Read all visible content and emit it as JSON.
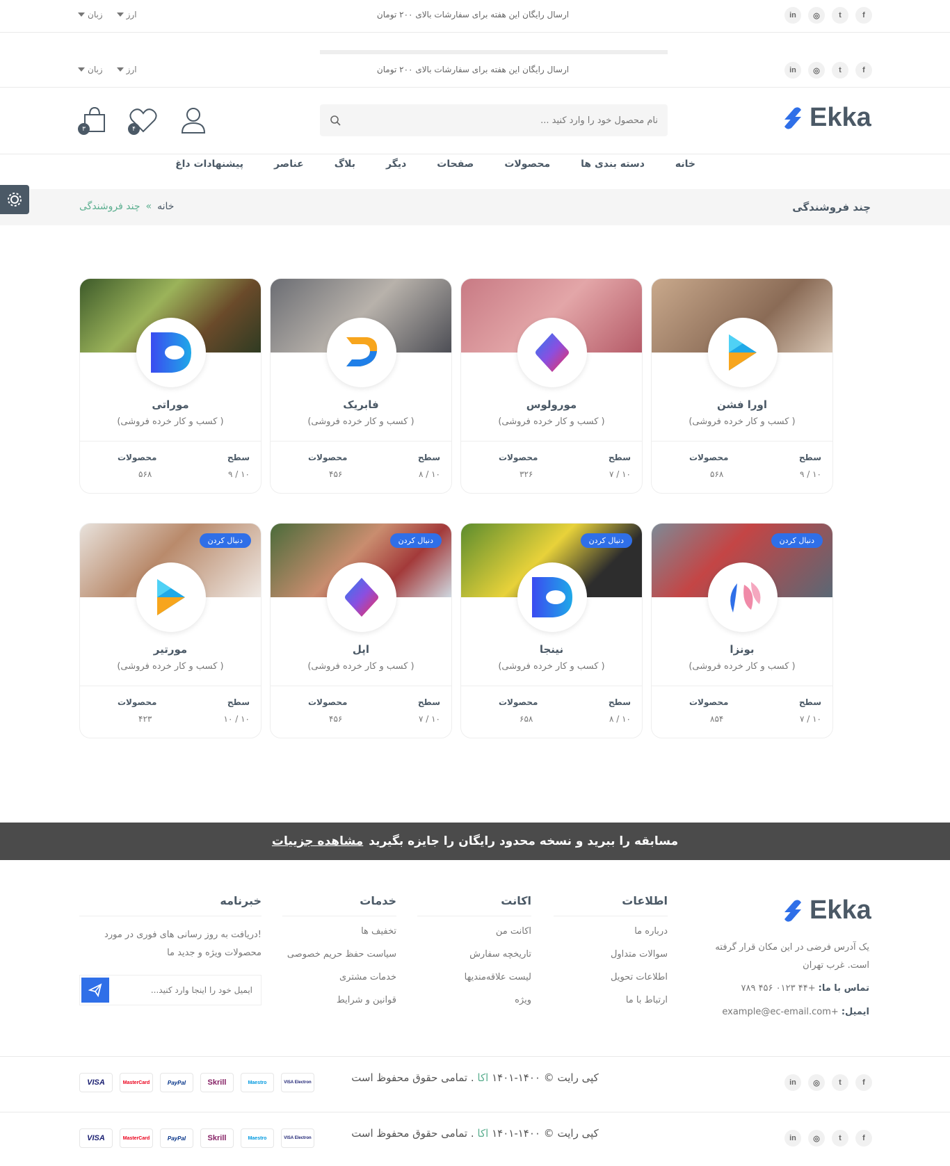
{
  "topbar": {
    "message": "ارسال رایگان این هفته برای سفارشات بالای ۲۰۰ تومان",
    "currency": "ارز",
    "language": "زبان",
    "social": [
      "f",
      "t",
      "ig",
      "in"
    ]
  },
  "header": {
    "logo": "Ekka",
    "search_placeholder": "نام محصول خود را وارد کنید ...",
    "wishlist_count": "۴",
    "cart_count": "۳"
  },
  "nav": [
    "خانه",
    "دسته بندی ها",
    "محصولات",
    "صفحات",
    "دیگر",
    "بلاگ",
    "عناصر",
    "پیشنهادات داغ"
  ],
  "breadcrumb": {
    "title": "چند فروشندگی",
    "home": "خانه",
    "sep": "»",
    "current": "چند فروشندگی"
  },
  "labels": {
    "level": "سطح",
    "products": "محصولات",
    "follow": "دنبال کردن"
  },
  "vendors": [
    {
      "name": "اورا فشن",
      "desc": "( کسب و کار خرده فروشی)",
      "level": "۱۰ / ۹",
      "products": "۵۶۸",
      "logo": "prism",
      "photo": "cart-laptop",
      "follow": false
    },
    {
      "name": "مورولوس",
      "desc": "( کسب و کار خرده فروشی)",
      "level": "۱۰ / ۷",
      "products": "۳۲۶",
      "logo": "capsule",
      "photo": "pink-women",
      "follow": false
    },
    {
      "name": "فابریک",
      "desc": "( کسب و کار خرده فروشی)",
      "level": "۱۰ / ۸",
      "products": "۴۵۶",
      "logo": "swirl",
      "photo": "shopping-bags",
      "follow": false
    },
    {
      "name": "موراتی",
      "desc": "( کسب و کار خرده فروشی)",
      "level": "۱۰ / ۹",
      "products": "۵۶۸",
      "logo": "dshape",
      "photo": "vegetables",
      "follow": false
    },
    {
      "name": "بونزا",
      "desc": "( کسب و کار خرده فروشی)",
      "level": "۱۰ / ۷",
      "products": "۸۵۴",
      "logo": "lotus",
      "photo": "trolley",
      "follow": true
    },
    {
      "name": "نینجا",
      "desc": "( کسب و کار خرده فروشی)",
      "level": "۱۰ / ۸",
      "products": "۶۵۸",
      "logo": "dshape",
      "photo": "fruit-market",
      "follow": true
    },
    {
      "name": "اپل",
      "desc": "( کسب و کار خرده فروشی)",
      "level": "۱۰ / ۷",
      "products": "۴۵۶",
      "logo": "capsule",
      "photo": "couple-apple",
      "follow": true
    },
    {
      "name": "مورتیر",
      "desc": "( کسب و کار خرده فروشی)",
      "level": "۱۰ / ۱۰",
      "products": "۴۲۳",
      "logo": "prism",
      "photo": "two-women",
      "follow": true
    }
  ],
  "promo": {
    "text": "مسابقه را ببرید و نسخه محدود رایگان را جایزه بگیرید",
    "link": "مشاهده جزییات"
  },
  "footer": {
    "about": "یک آدرس فرضی در این مکان قرار گرفته است. غرب تهران",
    "phone_label": "تماس با ما:",
    "phone": "+۴۴ ۰۱۲۳ ۴۵۶ ۷۸۹",
    "email_label": "ایمیل:",
    "email": "+example@ec-email.com",
    "col_info": {
      "title": "اطلاعات",
      "links": [
        "درباره ما",
        "سوالات متداول",
        "اطلاعات تحویل",
        "ارتباط با ما"
      ]
    },
    "col_account": {
      "title": "اکانت",
      "links": [
        "اکانت من",
        "تاریخچه سفارش",
        "لیست علاقه‌مندیها",
        "ویژه"
      ]
    },
    "col_services": {
      "title": "خدمات",
      "links": [
        "تخفیف ها",
        "سیاست حفظ حریم خصوصی",
        "خدمات مشتری",
        "قوانین و شرایط"
      ]
    },
    "newsletter": {
      "title": "خبرنامه",
      "text": "!دریافت به روز رسانی های فوری در مورد محصولات ویژه و جدید ما",
      "placeholder": "ایمیل خود را اینجا وارد کنید..."
    },
    "copyright_pre": "کپی رایت © ۱۴۰۰-۱۴۰۱",
    "copyright_brand": "اکا",
    "copyright_post": ". تمامی حقوق محفوظ است",
    "payments": [
      "VISA Electron",
      "Maestro",
      "Skrill",
      "PayPal",
      "MasterCard",
      "VISA"
    ]
  },
  "colors": {
    "primary": "#4b5966",
    "accent": "#5caf90",
    "logo_blue": "#2f6fe8"
  }
}
